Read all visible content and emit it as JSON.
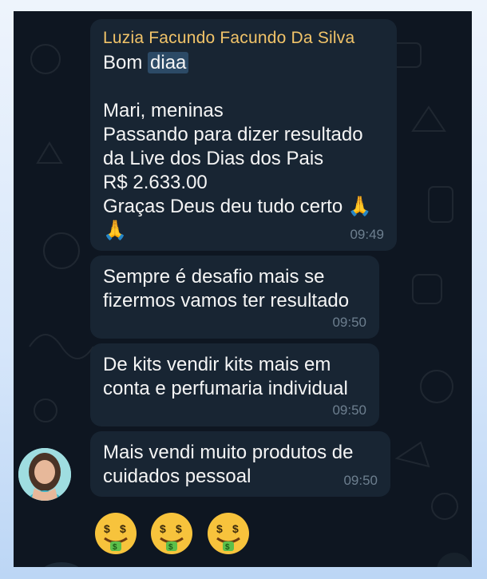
{
  "messages": [
    {
      "sender": "Luzia Facundo Facundo Da Silva",
      "greeting_prefix": "Bom",
      "greeting_highlight": "diaa",
      "body": "Mari, meninas\nPassando para dizer resultado\nda Live dos Dias dos Pais\nR$ 2.633.00\nGraças Deus deu tudo certo 🙏\n🙏",
      "time": "09:49"
    },
    {
      "text": "Sempre é desafio mais se\nfizermos vamos ter resultado",
      "time": "09:50"
    },
    {
      "text": "De kits vendir kits mais em\nconta e perfumaria individual",
      "time": "09:50"
    },
    {
      "text": "Mais vendi muito produtos de\ncuidados pessoal",
      "time": "09:50"
    }
  ],
  "reaction_emojis": [
    "money-mouth-face",
    "money-mouth-face",
    "money-mouth-face"
  ],
  "colors": {
    "chat_background": "#0e1621",
    "bubble": "#182533",
    "sender_name": "#f2c469",
    "timestamp": "#6d7f8f",
    "highlight": "#2c4a66"
  }
}
